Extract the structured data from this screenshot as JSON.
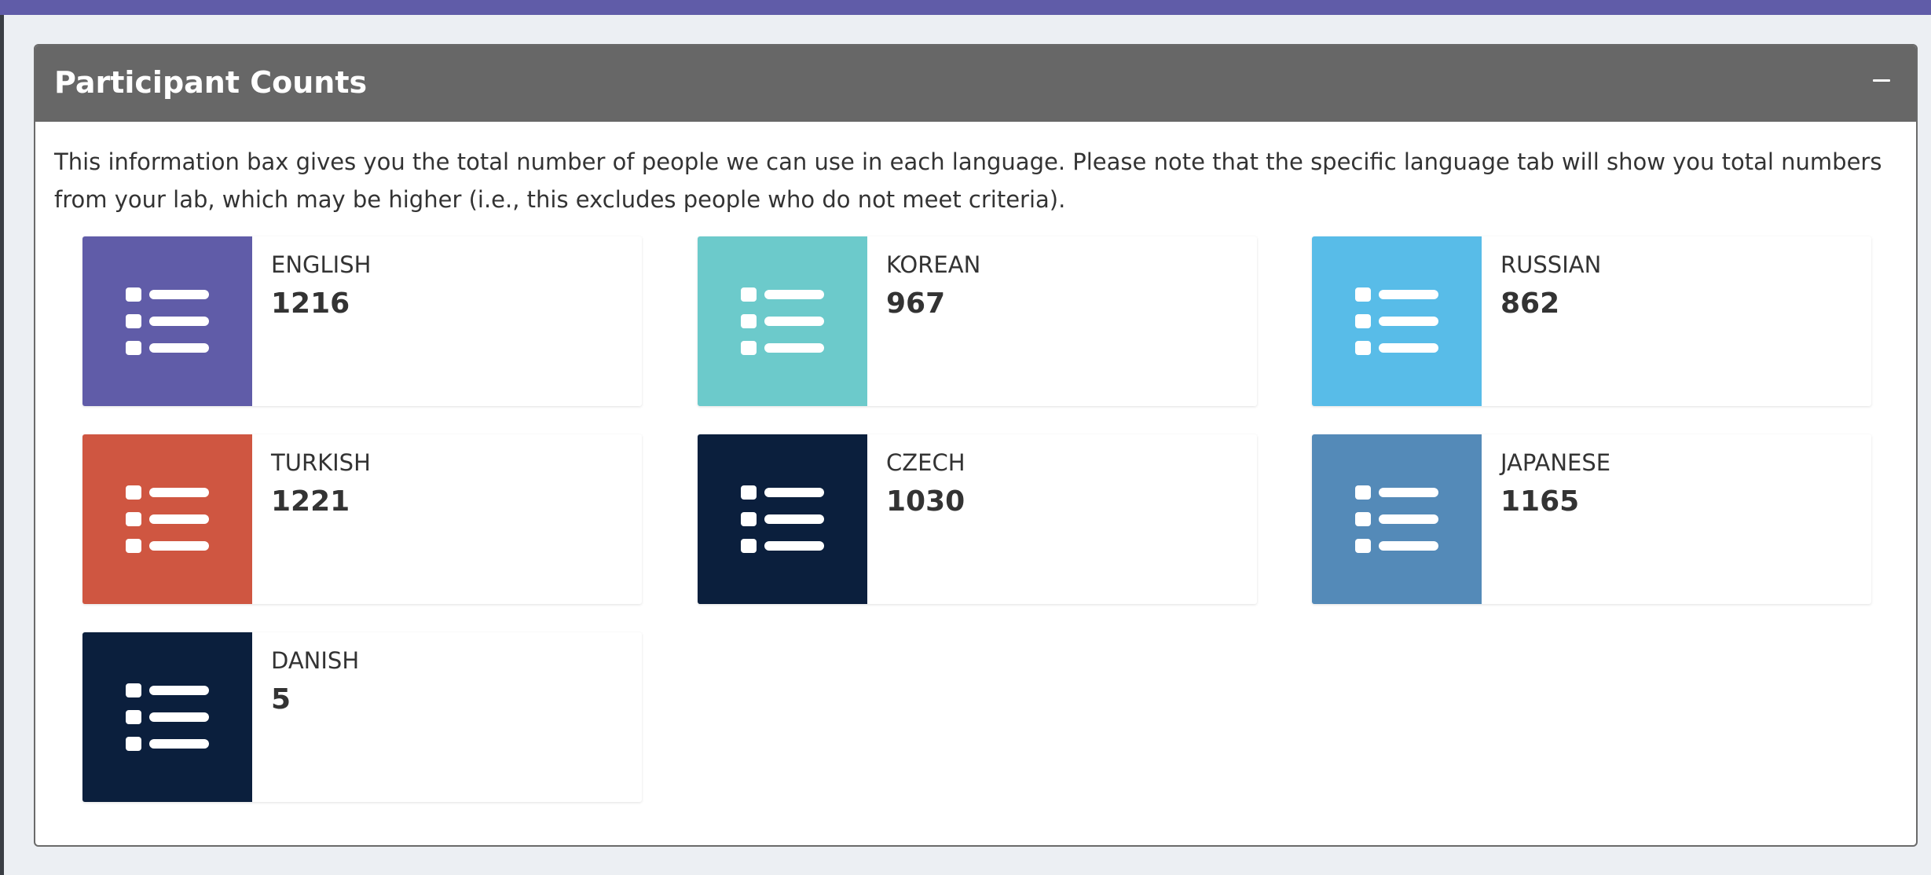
{
  "box": {
    "title": "Participant Counts",
    "description": "This information bax gives you the total number of people we can use in each language. Please note that the specific language tab will show you total numbers from your lab, which may be higher (i.e., this excludes people who do not meet criteria).",
    "collapse_icon": "minus-icon"
  },
  "languages": [
    {
      "label": "ENGLISH",
      "count": "1216",
      "color": "#605ca8",
      "icon": "list-icon"
    },
    {
      "label": "KOREAN",
      "count": "967",
      "color": "#6ccacb",
      "icon": "list-icon"
    },
    {
      "label": "RUSSIAN",
      "count": "862",
      "color": "#58bce8",
      "icon": "list-icon"
    },
    {
      "label": "TURKISH",
      "count": "1221",
      "color": "#cf5641",
      "icon": "list-icon"
    },
    {
      "label": "CZECH",
      "count": "1030",
      "color": "#0b1f3d",
      "icon": "list-icon"
    },
    {
      "label": "JAPANESE",
      "count": "1165",
      "color": "#548ab8",
      "icon": "list-icon"
    },
    {
      "label": "DANISH",
      "count": "5",
      "color": "#0b1f3d",
      "icon": "list-icon"
    }
  ],
  "colors": {
    "header_bg": "#676767",
    "top_bar": "#605ca8",
    "page_bg": "#eceff3"
  }
}
